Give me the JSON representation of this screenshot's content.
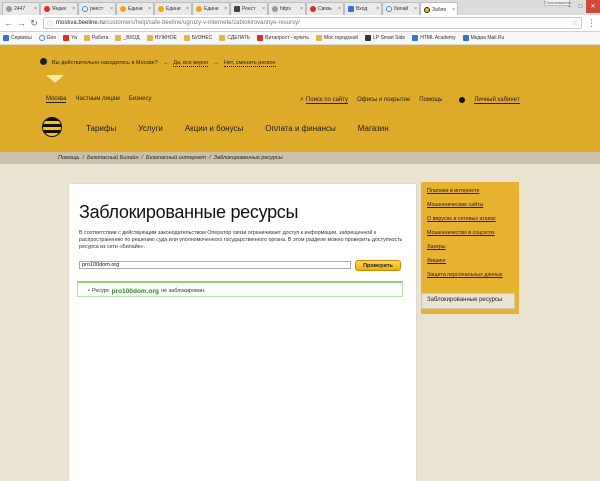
{
  "browser": {
    "tabs": [
      {
        "title": "2447",
        "icon": "favicon-icon-generic",
        "active": false
      },
      {
        "title": "Яндек",
        "icon": "yandex-icon",
        "active": false
      },
      {
        "title": "реест",
        "icon": "google-icon",
        "active": false
      },
      {
        "title": "Едини",
        "icon": "registry-icon",
        "active": false
      },
      {
        "title": "Едини",
        "icon": "registry-icon",
        "active": false
      },
      {
        "title": "Едини",
        "icon": "registry-icon",
        "active": false
      },
      {
        "title": "Реест",
        "icon": "registry-icon",
        "active": false
      },
      {
        "title": "https",
        "icon": "globe-icon",
        "active": false
      },
      {
        "title": "Связь",
        "icon": "rkn-icon",
        "active": false
      },
      {
        "title": "Вход",
        "icon": "mail-icon",
        "active": false
      },
      {
        "title": "билай",
        "icon": "google-icon",
        "active": false
      },
      {
        "title": "Забло",
        "icon": "beeline-icon",
        "active": true
      }
    ],
    "account_label": "Пользователь",
    "url_host": "moskva.beeline.ru",
    "url_path": "/customers/help/safe-beeline/ugrozy-v-internete/zablokirovannye-resursy/",
    "bookmarks": [
      {
        "label": "Сервисы",
        "icon": "apps-icon"
      },
      {
        "label": "Goo",
        "icon": "google-icon"
      },
      {
        "label": "Ya",
        "icon": "yandex-icon"
      },
      {
        "label": "Работа",
        "icon": "folder-icon"
      },
      {
        "label": "_ВХОД",
        "icon": "folder-icon"
      },
      {
        "label": "НУЖНОЕ",
        "icon": "folder-icon"
      },
      {
        "label": "БИЗНЕС",
        "icon": "folder-icon"
      },
      {
        "label": "СДЕЛАТЬ",
        "icon": "folder-icon"
      },
      {
        "label": "Витапрост - купить",
        "icon": "shop-icon"
      },
      {
        "label": "Мос городской",
        "icon": "folder-icon"
      },
      {
        "label": "LP Smart Side",
        "icon": "lp-icon"
      },
      {
        "label": "HTML Academy",
        "icon": "academy-icon"
      },
      {
        "label": "Медиа Mail.Ru",
        "icon": "mail-icon"
      }
    ]
  },
  "header": {
    "region_question": "Вы действительно находитесь в Москве?",
    "region_yes": "Да, все верно",
    "region_no": "Нет, сменить регион",
    "secondary_nav": [
      "Москва",
      "Частным лицам",
      "Бизнесу"
    ],
    "search_link": "Поиск по сайту",
    "offices_link": "Офисы и покрытие",
    "help_link": "Помощь",
    "cabinet_link": "Личный кабинет",
    "main_nav": [
      "Тарифы",
      "Услуги",
      "Акции и бонусы",
      "Оплата и финансы",
      "Магазин"
    ]
  },
  "breadcrumb": [
    "Помощь",
    "Безопасный Билайн",
    "Безопасный интернет",
    "Заблокированные ресурсы"
  ],
  "content": {
    "title": "Заблокированные ресурсы",
    "intro": "В соответствии с действующим законодательством Оператор связи ограничивает доступ к информации, запрещенной к распространению по решению суда или уполномоченного государственного органа. В этом разделе можно проверить доступность ресурса из сети «Билайн».",
    "input_value": "pro100dom.org",
    "button_label": "Проверить",
    "result_prefix": "Ресурс",
    "result_domain": "pro100dom.org",
    "result_suffix": "не заблокирован."
  },
  "sidebar": {
    "items": [
      "Платежи в интернете",
      "Мошеннические сайты",
      "О вирусах и сетевых атаках",
      "Мошенничество в соцсетях",
      "Хакеры",
      "Фишинг",
      "Защита персональных данных"
    ],
    "active": "Заблокированные ресурсы"
  },
  "colors": {
    "brand_yellow": "#deaa2a",
    "button_yellow": "#f4ae00",
    "success_green": "#2f8a1a",
    "page_background": "#eae3d1"
  }
}
